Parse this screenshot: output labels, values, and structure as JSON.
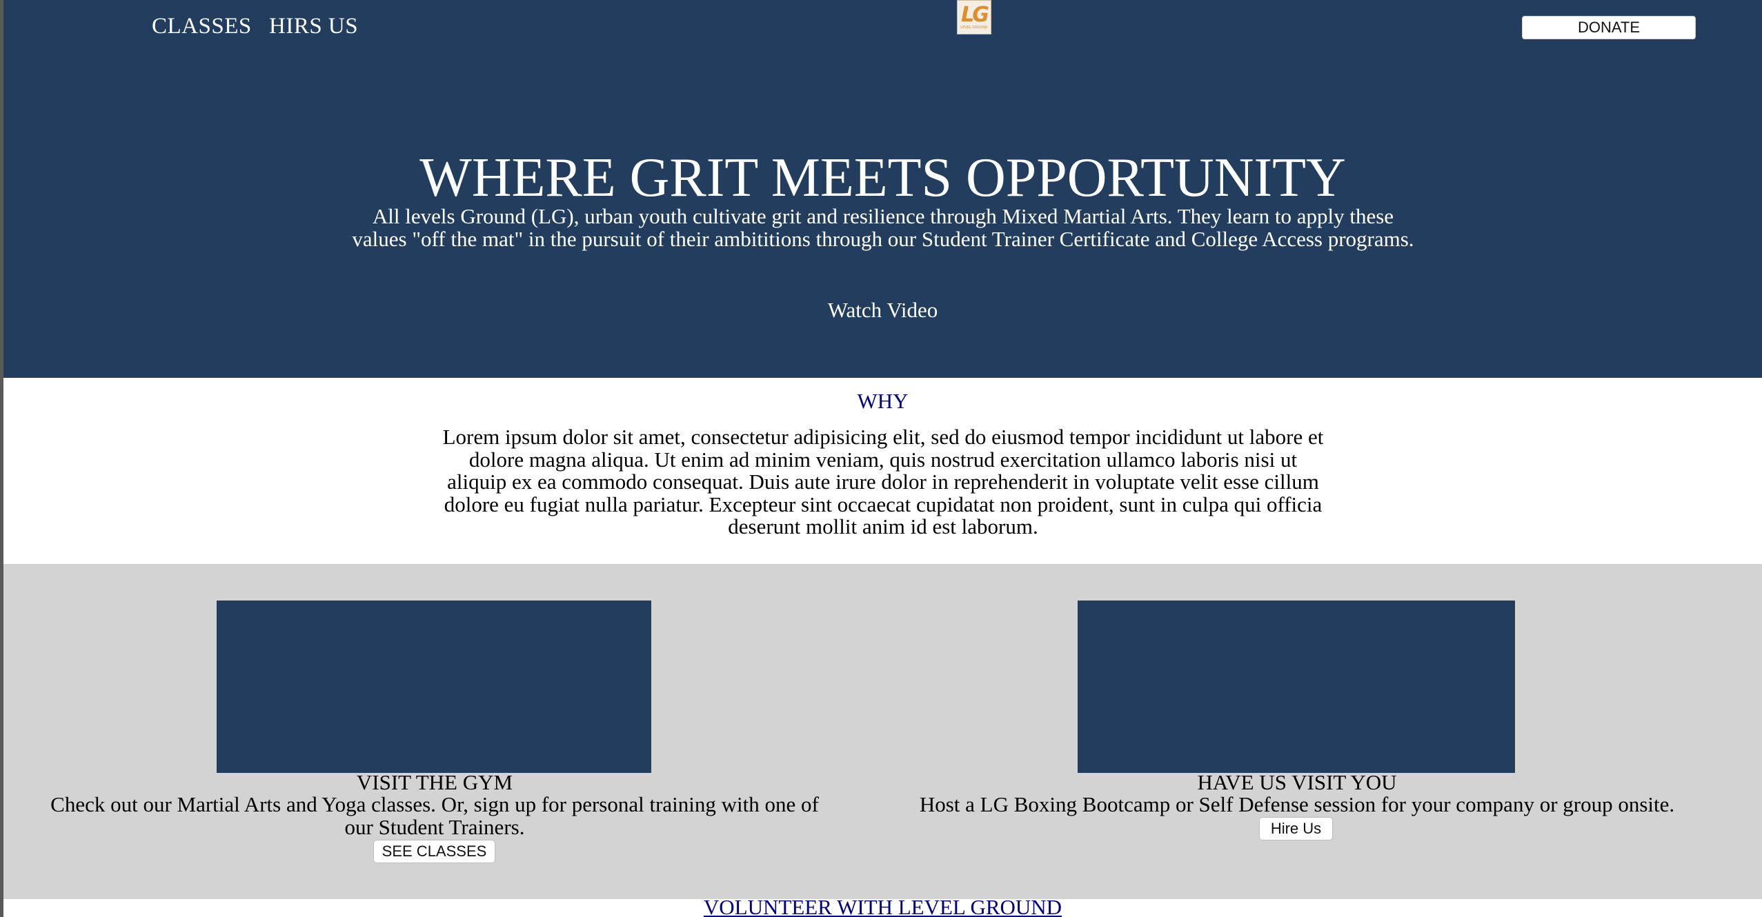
{
  "nav": {
    "classes_label": "CLASSES",
    "hire_label": "HIRS US",
    "donate_label": "DONATE"
  },
  "logo": {
    "mark": "LG",
    "subtitle": "LEVEL GROUND"
  },
  "hero": {
    "title": "WHERE GRIT MEETS OPPORTUNITY",
    "text": "All levels Ground (LG), urban youth cultivate grit and resilience through Mixed Martial Arts. They learn to apply these values \"off the mat\" in the pursuit of their ambititions through our Student Trainer Certificate and College Access programs.",
    "watch_label": "Watch Video"
  },
  "why": {
    "title": "WHY",
    "text": "Lorem ipsum dolor sit amet, consectetur adipisicing elit, sed do eiusmod tempor incididunt ut labore et dolore magna aliqua. Ut enim ad minim veniam, quis nostrud exercitation ullamco laboris nisi ut aliquip ex ea commodo consequat. Duis aute irure dolor in reprehenderit in voluptate velit esse cillum dolore eu fugiat nulla pariatur. Excepteur sint occaecat cupidatat non proident, sunt in culpa qui officia deserunt mollit anim id est laborum."
  },
  "cards": [
    {
      "title": "VISIT THE GYM",
      "text": "Check out our Martial Arts and Yoga classes. Or, sign up for personal training with one of our Student Trainers.",
      "button_label": "SEE CLASSES"
    },
    {
      "title": "HAVE US VISIT YOU",
      "text": "Host a LG Boxing Bootcamp or Self Defense session for your company or group onsite.",
      "button_label": "Hire Us"
    }
  ],
  "volunteer": {
    "label": "VOLUNTEER WITH LEVEL GROUND"
  },
  "colors": {
    "navy": "#233d5e",
    "heading_blue": "#000080",
    "section_gray": "#d3d3d3",
    "logo_orange": "#e08c2a"
  }
}
